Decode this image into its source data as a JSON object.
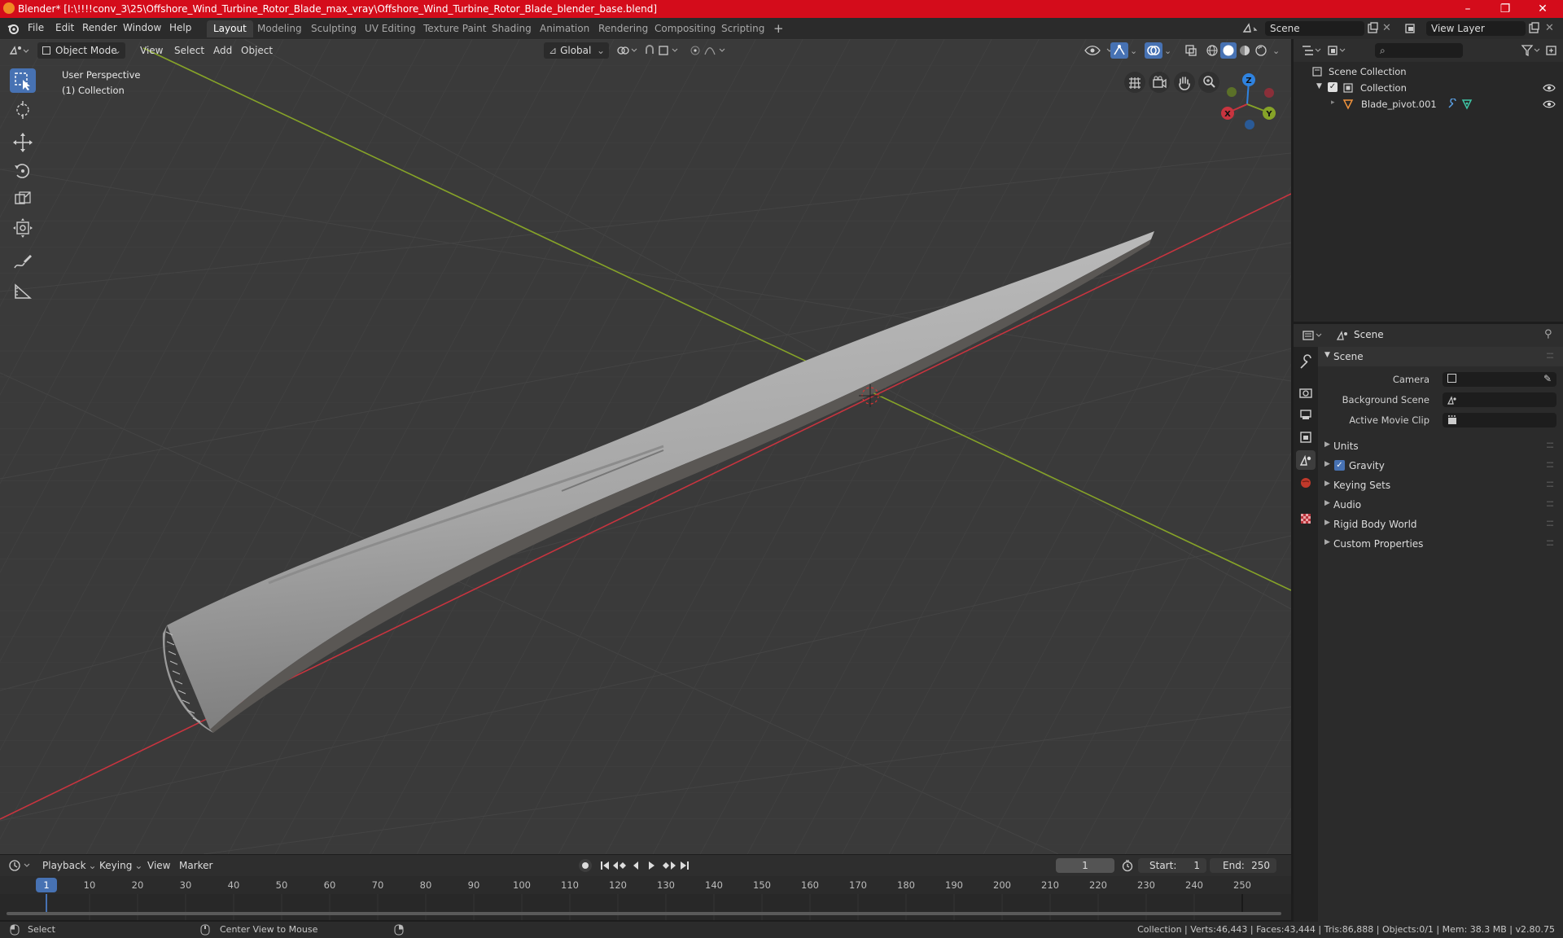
{
  "window": {
    "title": "Blender* [I:\\!!!!conv_3\\25\\Offshore_Wind_Turbine_Rotor_Blade_max_vray\\Offshore_Wind_Turbine_Rotor_Blade_blender_base.blend]",
    "controls": [
      "–",
      "❐",
      "✕"
    ]
  },
  "menubar": {
    "menus": [
      "File",
      "Edit",
      "Render",
      "Window",
      "Help"
    ],
    "workspaces": [
      "Layout",
      "Modeling",
      "Sculpting",
      "UV Editing",
      "Texture Paint",
      "Shading",
      "Animation",
      "Rendering",
      "Compositing",
      "Scripting"
    ],
    "active_workspace": "Layout",
    "add_workspace": "+",
    "scene": "Scene",
    "view_layer": "View Layer"
  },
  "viewport_header": {
    "mode": "Object Mode",
    "menus": [
      "View",
      "Select",
      "Add",
      "Object"
    ],
    "transform_orientation": "Global"
  },
  "viewport": {
    "perspective_label": "User Perspective",
    "collection_label": "(1) Collection",
    "gizmo_axes": {
      "x": "X",
      "y": "Y",
      "z": "Z"
    },
    "colors": {
      "background": "#3a3a3a",
      "x_axis": "#c8343f",
      "y_axis": "#86a328",
      "z_axis": "#2f83e0",
      "blade": "#a9a9a9"
    }
  },
  "toolbar": {
    "tools": [
      "select-box",
      "cursor",
      "move",
      "rotate",
      "scale",
      "transform",
      "annotate",
      "measure"
    ],
    "active_tool": "select-box"
  },
  "outliner": {
    "search_placeholder": "",
    "root": "Scene Collection",
    "items": [
      {
        "label": "Collection",
        "depth": 1,
        "checked": true
      },
      {
        "label": "Blade_pivot.001",
        "depth": 2
      }
    ]
  },
  "properties": {
    "header_title": "Scene",
    "panel_title": "Scene",
    "fields": [
      {
        "label": "Camera",
        "value": ""
      },
      {
        "label": "Background Scene",
        "value": ""
      },
      {
        "label": "Active Movie Clip",
        "value": ""
      }
    ],
    "subpanels": [
      {
        "label": "Units",
        "checkbox": false
      },
      {
        "label": "Gravity",
        "checkbox": true
      },
      {
        "label": "Keying Sets",
        "checkbox": false
      },
      {
        "label": "Audio",
        "checkbox": false
      },
      {
        "label": "Rigid Body World",
        "checkbox": false
      },
      {
        "label": "Custom Properties",
        "checkbox": false
      }
    ]
  },
  "timeline": {
    "menus": [
      "Playback",
      "Keying",
      "View",
      "Marker"
    ],
    "current_frame": "1",
    "start_label": "Start:",
    "start": "1",
    "end_label": "End:",
    "end": "250",
    "ticks": [
      "1",
      "10",
      "20",
      "30",
      "40",
      "50",
      "60",
      "70",
      "80",
      "90",
      "100",
      "110",
      "120",
      "130",
      "140",
      "150",
      "160",
      "170",
      "180",
      "190",
      "200",
      "210",
      "220",
      "230",
      "240",
      "250"
    ]
  },
  "statusbar": {
    "left_action": "Select",
    "middle_action": "Center View to Mouse",
    "stats": "Collection | Verts:46,443 | Faces:43,444 | Tris:86,888 | Objects:0/1 | Mem: 38.3 MB | v2.80.75"
  }
}
